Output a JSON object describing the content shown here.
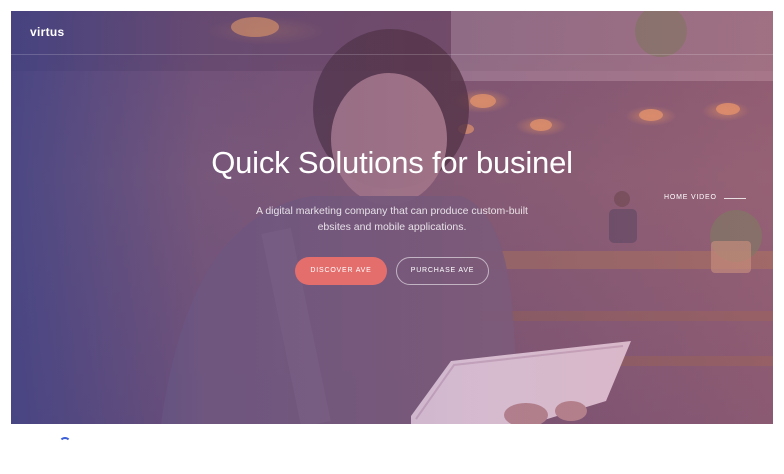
{
  "brand": {
    "logo": "virtus"
  },
  "hero": {
    "headline": "Quick Solutions for businel",
    "subtext": "A digital marketing company that can produce custom-built ebsites and mobile applications.",
    "primary_button": "DISCOVER AVE",
    "secondary_button": "PURCHASE AVE",
    "video_link": "HOME VIDEO"
  },
  "colors": {
    "accent": "#e46e6c",
    "overlay_left": "#3c428c",
    "overlay_right": "#c86e82",
    "spinner": "#3d5fd8"
  },
  "icons": [
    "loading-spinner-icon"
  ]
}
